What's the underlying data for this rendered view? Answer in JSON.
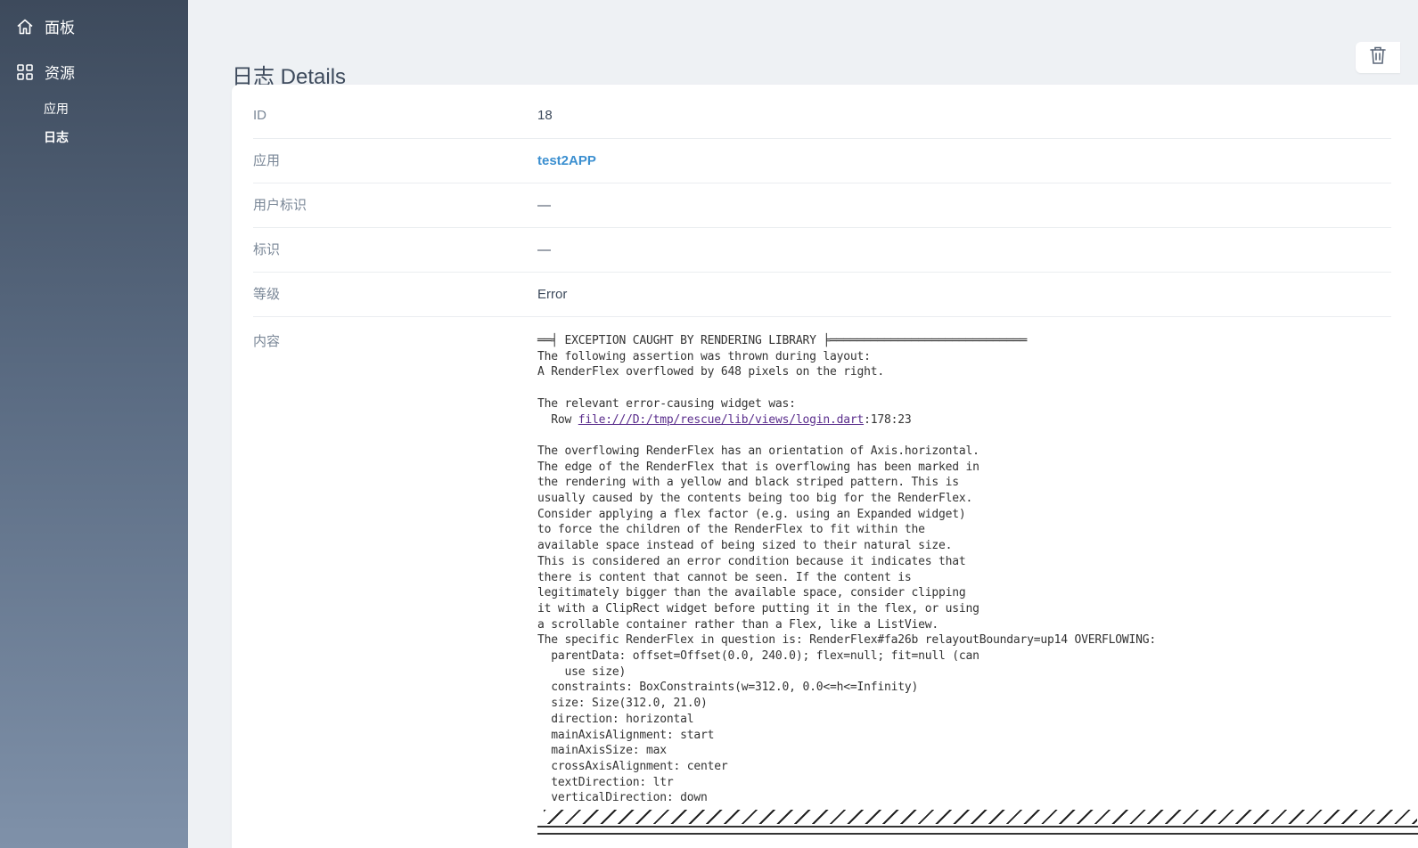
{
  "sidebar": {
    "dashboard": {
      "label": "面板",
      "icon": "home-icon"
    },
    "resources": {
      "label": "资源",
      "icon": "grid-icon"
    },
    "sub_items": [
      {
        "label": "应用"
      },
      {
        "label": "日志"
      }
    ]
  },
  "page": {
    "title": "日志 Details",
    "delete_icon": "trash-icon"
  },
  "details": [
    {
      "label": "ID",
      "value": "18"
    },
    {
      "label": "应用",
      "value": "test2APP"
    },
    {
      "label": "用户标识",
      "value": "—"
    },
    {
      "label": "标识",
      "value": "—"
    },
    {
      "label": "等级",
      "value": "Error"
    }
  ],
  "content": {
    "label": "内容",
    "line_header": "══╡ EXCEPTION CAUGHT BY RENDERING LIBRARY ╞═════════════════════════════",
    "line_1": "The following assertion was thrown during layout:",
    "line_2": "A RenderFlex overflowed by 648 pixels on the right.",
    "line_3": "The relevant error-causing widget was:",
    "widget_prefix": "  Row ",
    "file_link": "file:///D:/tmp/rescue/lib/views/login.dart",
    "file_suffix": ":178:23",
    "body": "The overflowing RenderFlex has an orientation of Axis.horizontal.\nThe edge of the RenderFlex that is overflowing has been marked in\nthe rendering with a yellow and black striped pattern. This is\nusually caused by the contents being too big for the RenderFlex.\nConsider applying a flex factor (e.g. using an Expanded widget)\nto force the children of the RenderFlex to fit within the\navailable space instead of being sized to their natural size.\nThis is considered an error condition because it indicates that\nthere is content that cannot be seen. If the content is\nlegitimately bigger than the available space, consider clipping\nit with a ClipRect widget before putting it in the flex, or using\na scrollable container rather than a Flex, like a ListView.\nThe specific RenderFlex in question is: RenderFlex#fa26b relayoutBoundary=up14 OVERFLOWING:\n  parentData: offset=Offset(0.0, 240.0); flex=null; fit=null (can\n    use size)\n  constraints: BoxConstraints(w=312.0, 0.0<=h<=Infinity)\n  size: Size(312.0, 21.0)\n  direction: horizontal\n  mainAxisAlignment: start\n  mainAxisSize: max\n  crossAxisAlignment: center\n  textDirection: ltr\n  verticalDirection: down"
  }
}
